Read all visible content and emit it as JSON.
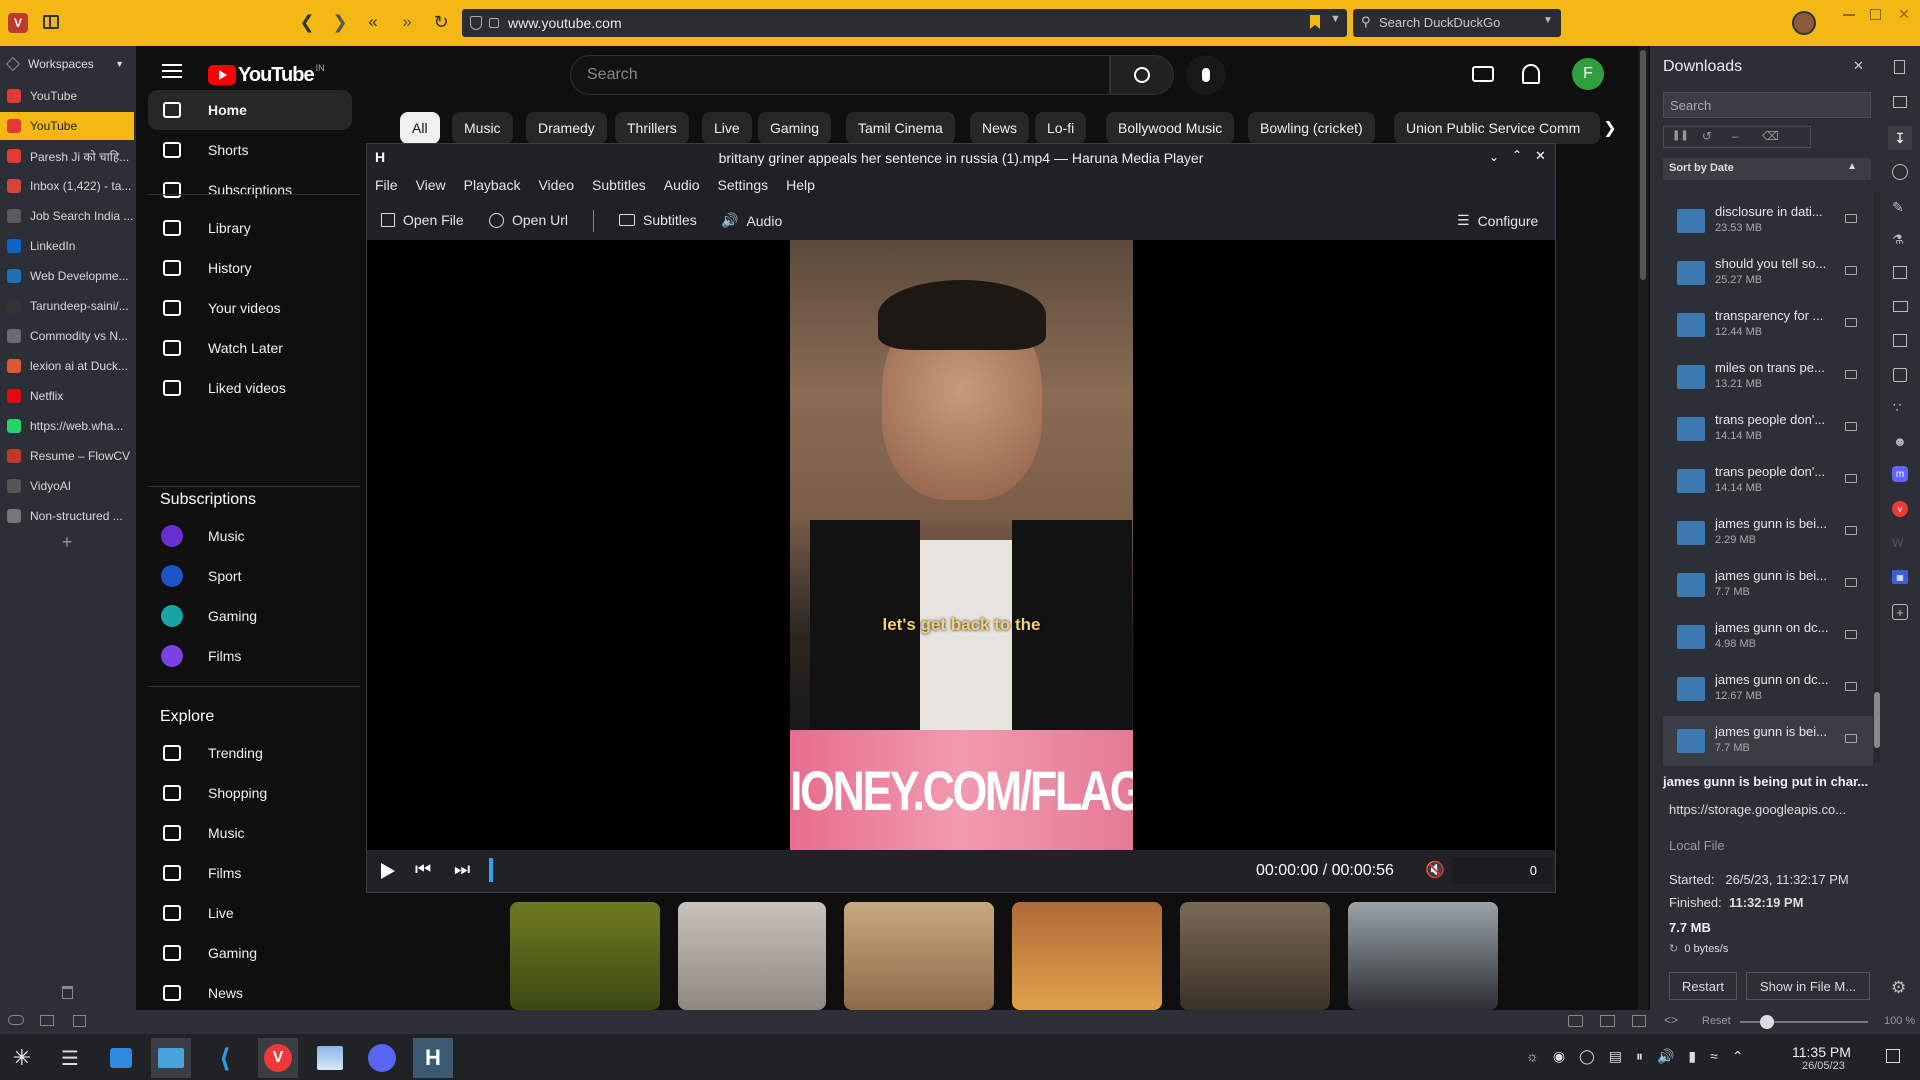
{
  "browser": {
    "url": "www.youtube.com",
    "search_placeholder": "Search DuckDuckGo",
    "accent": "#f4b814"
  },
  "panel": {
    "workspaces_label": "Workspaces",
    "tabs": [
      {
        "label": "YouTube",
        "color": "#e53935",
        "icon": "youtube-icon"
      },
      {
        "label": "YouTube",
        "color": "#e53935",
        "icon": "youtube-icon",
        "active": true
      },
      {
        "label": "Paresh Ji को चाहि...",
        "color": "#e53935",
        "icon": "youtube-icon"
      },
      {
        "label": "Inbox (1,422) - ta...",
        "color": "#d44638",
        "icon": "gmail-icon"
      },
      {
        "label": "Job Search India ...",
        "color": "#5a5a5a",
        "icon": "info-icon"
      },
      {
        "label": "LinkedIn",
        "color": "#0a66c2",
        "icon": "linkedin-icon"
      },
      {
        "label": "Web Developme...",
        "color": "#1f6fb2",
        "icon": "site-icon"
      },
      {
        "label": "Tarundeep-saini/...",
        "color": "#333333",
        "icon": "github-icon"
      },
      {
        "label": "Commodity vs N...",
        "color": "#6b6b6b",
        "icon": "site-icon"
      },
      {
        "label": "lexion ai at Duck...",
        "color": "#de5833",
        "icon": "duckduckgo-icon"
      },
      {
        "label": "Netflix",
        "color": "#e50914",
        "icon": "netflix-icon"
      },
      {
        "label": "https://web.wha...",
        "color": "#25d366",
        "icon": "whatsapp-icon"
      },
      {
        "label": "Resume – FlowCV",
        "color": "#c0392b",
        "icon": "site-icon"
      },
      {
        "label": "VidyoAI",
        "color": "#555555",
        "icon": "site-icon"
      },
      {
        "label": "Non-structured ...",
        "color": "#777777",
        "icon": "wikipedia-icon"
      }
    ]
  },
  "youtube": {
    "logo_text": "YouTube",
    "region": "IN",
    "search_placeholder": "Search",
    "avatar_letter": "F",
    "nav": [
      {
        "label": "Home",
        "icon": "home-icon",
        "active": true
      },
      {
        "label": "Shorts",
        "icon": "shorts-icon"
      },
      {
        "label": "Subscriptions",
        "icon": "subscriptions-icon"
      }
    ],
    "library": [
      {
        "label": "Library",
        "icon": "library-icon"
      },
      {
        "label": "History",
        "icon": "history-icon"
      },
      {
        "label": "Your videos",
        "icon": "your-videos-icon"
      },
      {
        "label": "Watch Later",
        "icon": "watch-later-icon"
      },
      {
        "label": "Liked videos",
        "icon": "like-icon"
      }
    ],
    "subscriptions_heading": "Subscriptions",
    "subscriptions": [
      {
        "label": "Music",
        "color": "#6a2fd1"
      },
      {
        "label": "Sport",
        "color": "#1a54c6"
      },
      {
        "label": "Gaming",
        "color": "#1aa3a3"
      },
      {
        "label": "Films",
        "color": "#7b3fe4"
      }
    ],
    "explore_heading": "Explore",
    "explore": [
      {
        "label": "Trending",
        "icon": "trending-icon"
      },
      {
        "label": "Shopping",
        "icon": "shopping-icon"
      },
      {
        "label": "Music",
        "icon": "music-note-icon"
      },
      {
        "label": "Films",
        "icon": "film-icon"
      },
      {
        "label": "Live",
        "icon": "live-icon"
      },
      {
        "label": "Gaming",
        "icon": "gaming-icon"
      },
      {
        "label": "News",
        "icon": "news-icon"
      }
    ],
    "chips": [
      "All",
      "Music",
      "Dramedy",
      "Thrillers",
      "Live",
      "Gaming",
      "Tamil Cinema",
      "News",
      "Lo-fi",
      "Bollywood Music",
      "Bowling (cricket)",
      "Union Public Service Comm"
    ]
  },
  "player": {
    "title": "brittany griner appeals her sentence in russia (1).mp4 — Haruna Media Player",
    "menu": [
      "File",
      "View",
      "Playback",
      "Video",
      "Subtitles",
      "Audio",
      "Settings",
      "Help"
    ],
    "toolbar": {
      "open_file": "Open File",
      "open_url": "Open Url",
      "subtitles": "Subtitles",
      "audio": "Audio",
      "configure": "Configure"
    },
    "subtitle_text": "let's get back to the",
    "banner_text": "IONEY.COM/FLAGR",
    "time": "00:00:00 / 00:00:56",
    "volume_value": "0",
    "progress": 0.0
  },
  "downloads": {
    "title": "Downloads",
    "search_placeholder": "Search",
    "sort_label": "Sort by Date",
    "items": [
      {
        "name": "disclosure in dati...",
        "size": "23.53 MB"
      },
      {
        "name": "should you tell so...",
        "size": "25.27 MB"
      },
      {
        "name": "transparency for ...",
        "size": "12.44 MB"
      },
      {
        "name": "miles on trans pe...",
        "size": "13.21 MB"
      },
      {
        "name": "trans people don'...",
        "size": "14.14 MB"
      },
      {
        "name": "trans people don'...",
        "size": "14.14 MB"
      },
      {
        "name": "james gunn is bei...",
        "size": "2.29 MB"
      },
      {
        "name": "james gunn is bei...",
        "size": "7.7 MB"
      },
      {
        "name": "james gunn on dc...",
        "size": "4.98 MB"
      },
      {
        "name": "james gunn on dc...",
        "size": "12.67 MB"
      },
      {
        "name": "james gunn is bei...",
        "size": "7.7 MB",
        "selected": true
      }
    ],
    "detail": {
      "name": "james gunn is being put in char...",
      "url": "https://storage.googleapis.co...",
      "local_file": "Local File",
      "started_label": "Started:",
      "started": "26/5/23, 11:32:17 PM",
      "finished_label": "Finished:",
      "finished": "11:32:19 PM",
      "size": "7.7 MB",
      "speed": "0 bytes/s",
      "restart": "Restart",
      "show_in_file": "Show in File M..."
    }
  },
  "statusbar": {
    "reset": "Reset",
    "zoom": "100 %"
  },
  "taskbar": {
    "time": "11:35 PM",
    "date": "26/05/23"
  }
}
